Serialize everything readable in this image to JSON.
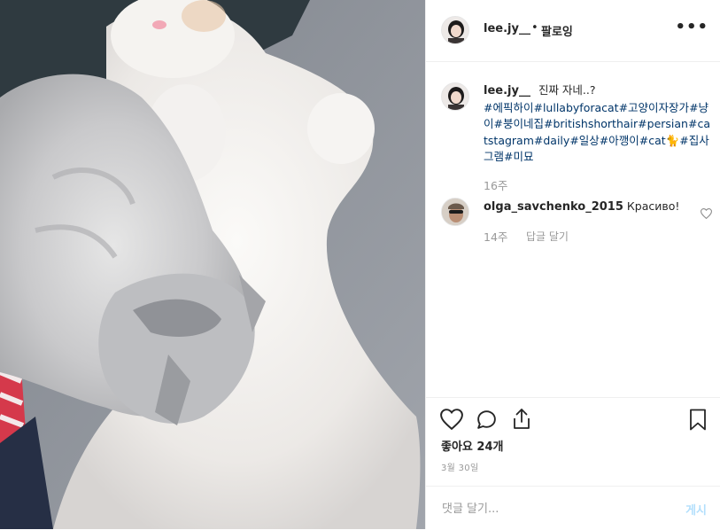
{
  "post": {
    "author": "lee.jy__",
    "follow_separator": "•",
    "follow_label": "팔로잉",
    "more_icon": "more-horizontal-icon"
  },
  "caption": {
    "author": "lee.jy__",
    "text": "진짜 자네..?",
    "hashtags": [
      "#에픽하이",
      "#lullabyforacat",
      "#고양이자장가",
      "#냥이",
      "#붕이네집",
      "#britishshorthair",
      "#persian",
      "#catstagram",
      "#daily",
      "#일상",
      "#아깽이",
      "#cat",
      "🐈",
      "#집사그램",
      "#미묘"
    ],
    "time": "16주"
  },
  "comments": [
    {
      "author": "olga_savchenko_2015",
      "text": "Красиво!",
      "time": "14주",
      "reply_label": "답글 달기"
    }
  ],
  "actions": {
    "likes_text": "좋아요 24개",
    "date_text": "3월 30일"
  },
  "comment_box": {
    "placeholder": "댓글 달기...",
    "post_label": "게시"
  },
  "colors": {
    "text": "#262626",
    "muted": "#999999",
    "hashtag": "#003569",
    "post_button": "#b2dffc",
    "border": "#efefef"
  }
}
